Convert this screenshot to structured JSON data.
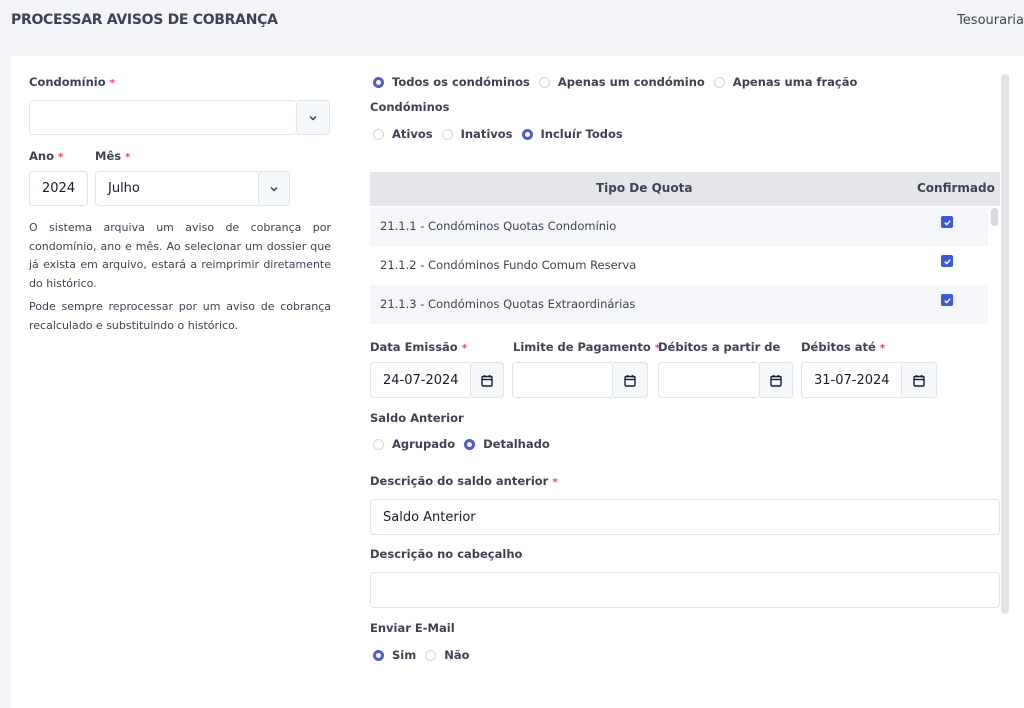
{
  "header": {
    "title": "PROCESSAR AVISOS DE COBRANÇA",
    "breadcrumb": "Tesouraria"
  },
  "left": {
    "condominio": {
      "label": "Condomínio",
      "value": ""
    },
    "ano": {
      "label": "Ano",
      "value": "2024"
    },
    "mes": {
      "label": "Mês",
      "value": "Julho"
    },
    "help1": "O sistema arquiva um aviso de cobrança por condomínio, ano e mês. Ao selecionar um dossier que já exista em arquivo, estará a reimprimir diretamente do histórico.",
    "help2": "Pode sempre reprocessar por um aviso de cobrança recalculado e substituindo o histórico.",
    "required_mark": "*"
  },
  "scope": {
    "options": [
      "Todos os condóminos",
      "Apenas um condómino",
      "Apenas uma fração"
    ],
    "selected": 0
  },
  "condominos": {
    "label": "Condóminos",
    "options": [
      "Ativos",
      "Inativos",
      "Incluír Todos"
    ],
    "selected": 2
  },
  "quota_table": {
    "headers": [
      "Tipo De Quota",
      "Confirmado"
    ],
    "rows": [
      {
        "tipo": "21.1.1 - Condóminos Quotas Condomínio",
        "confirmado": true
      },
      {
        "tipo": "21.1.2 - Condóminos Fundo Comum Reserva",
        "confirmado": true
      },
      {
        "tipo": "21.1.3 - Condóminos Quotas Extraordinárias",
        "confirmado": true
      }
    ]
  },
  "dates": {
    "emissao": {
      "label": "Data Emissão",
      "value": "24-07-2024"
    },
    "limite": {
      "label": "Limite de Pagamento",
      "value": ""
    },
    "debitos_de": {
      "label": "Débitos a partir de",
      "value": ""
    },
    "debitos_ate": {
      "label": "Débitos até",
      "value": "31-07-2024"
    }
  },
  "saldo": {
    "label": "Saldo Anterior",
    "options": [
      "Agrupado",
      "Detalhado"
    ],
    "selected": 1
  },
  "descricao_saldo": {
    "label": "Descrição do saldo anterior",
    "value": "Saldo Anterior"
  },
  "descricao_cabecalho": {
    "label": "Descrição no cabeçalho",
    "value": ""
  },
  "email": {
    "label": "Enviar E-Mail",
    "options": [
      "Sim",
      "Não"
    ],
    "selected": 0
  },
  "colors": {
    "accent": "#4f5bd5",
    "checkbox": "#3b5bdb",
    "required": "#f1416c",
    "table_header": "#e4e6ea"
  }
}
